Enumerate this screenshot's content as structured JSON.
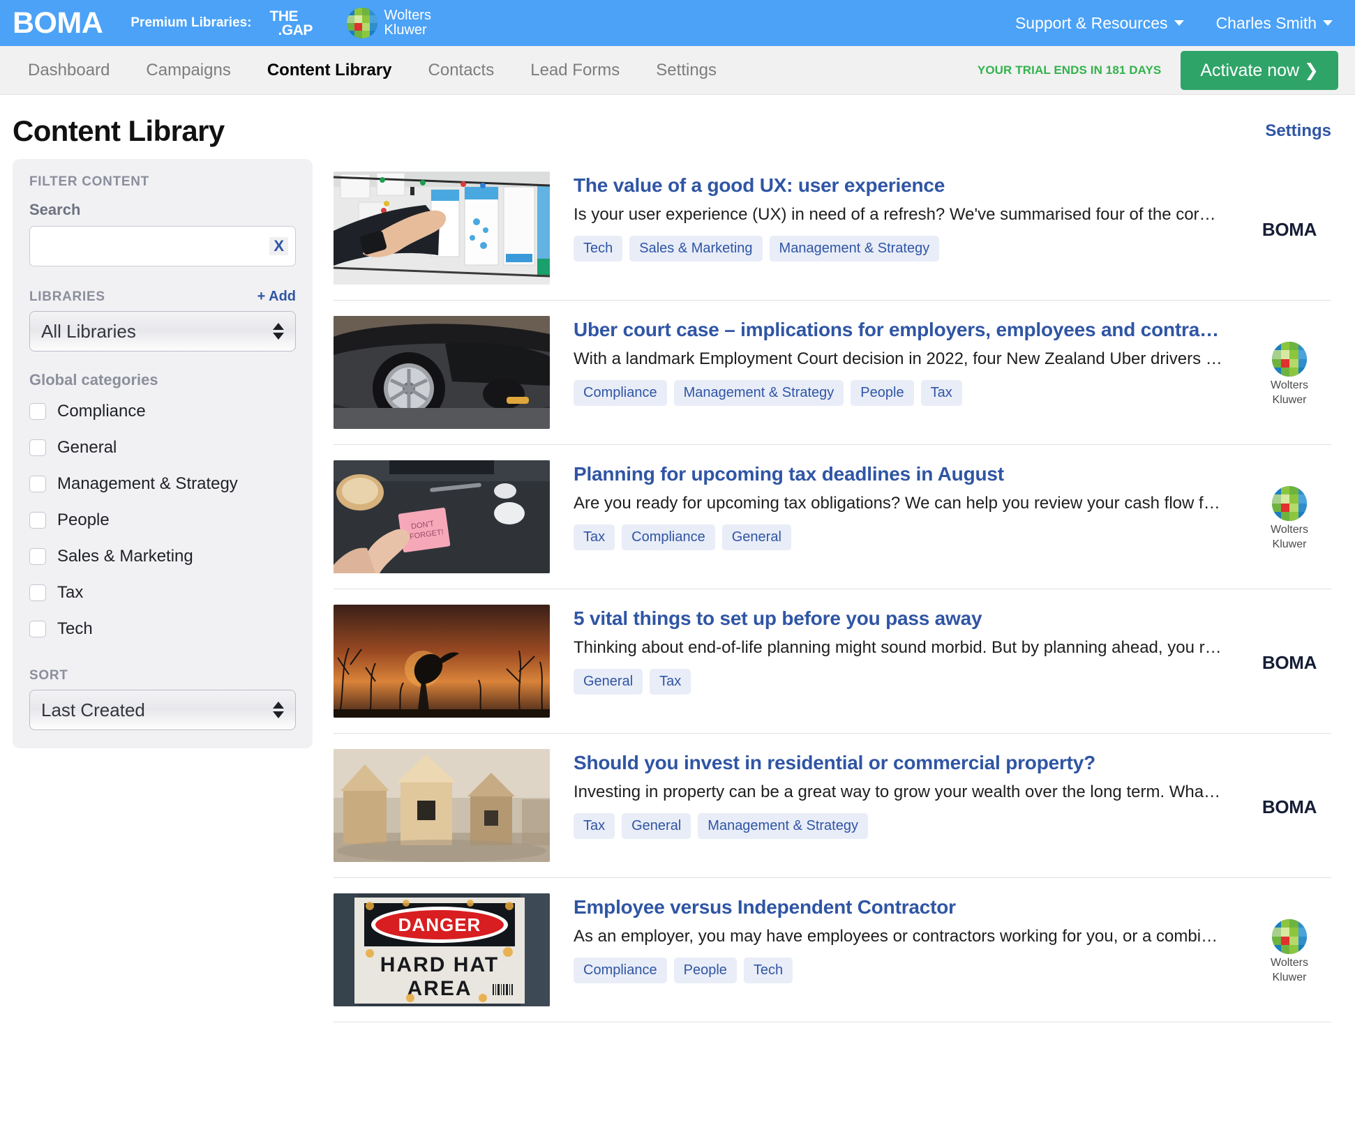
{
  "topbar": {
    "logo": "BOMA",
    "premium_label": "Premium Libraries:",
    "thegap_line1": "THE",
    "thegap_line2": ".GAP",
    "wolters_line1": "Wolters",
    "wolters_line2": "Kluwer",
    "support_menu": "Support & Resources",
    "user_menu": "Charles Smith"
  },
  "nav": {
    "items": [
      {
        "label": "Dashboard",
        "active": false
      },
      {
        "label": "Campaigns",
        "active": false
      },
      {
        "label": "Content Library",
        "active": true
      },
      {
        "label": "Contacts",
        "active": false
      },
      {
        "label": "Lead Forms",
        "active": false
      },
      {
        "label": "Settings",
        "active": false
      }
    ],
    "trial_text": "YOUR TRIAL ENDS IN 181 DAYS",
    "activate_label": "Activate now ❯"
  },
  "page": {
    "title": "Content Library",
    "settings_link": "Settings"
  },
  "sidebar": {
    "filter_title": "FILTER CONTENT",
    "search_label": "Search",
    "search_value": "",
    "search_placeholder": "",
    "search_clear_label": "X",
    "libraries_label": "LIBRARIES",
    "add_label": "+ Add",
    "library_selected": "All Libraries",
    "global_categories_label": "Global categories",
    "categories": [
      {
        "label": "Compliance",
        "checked": false
      },
      {
        "label": "General",
        "checked": false
      },
      {
        "label": "Management & Strategy",
        "checked": false
      },
      {
        "label": "People",
        "checked": false
      },
      {
        "label": "Sales & Marketing",
        "checked": false
      },
      {
        "label": "Tax",
        "checked": false
      },
      {
        "label": "Tech",
        "checked": false
      }
    ],
    "sort_label": "SORT",
    "sort_selected": "Last Created"
  },
  "content_items": [
    {
      "title": "The value of a good UX: user experience",
      "description": "Is your user experience (UX) in need of a refresh? We've summarised four of the core are…",
      "tags": [
        "Tech",
        "Sales & Marketing",
        "Management & Strategy"
      ],
      "brand": "BOMA",
      "thumb": "ux-sticky-notes-wall"
    },
    {
      "title": "Uber court case – implications for employers, employees and contract…",
      "description": "With a landmark Employment Court decision in 2022, four New Zealand Uber drivers wo…",
      "tags": [
        "Compliance",
        "Management & Strategy",
        "People",
        "Tax"
      ],
      "brand": "Wolters Kluwer",
      "thumb": "car-wheel"
    },
    {
      "title": "Planning for upcoming tax deadlines in August",
      "description": "Are you ready for upcoming tax obligations? We can help you review your cash flow fore…",
      "tags": [
        "Tax",
        "Compliance",
        "General"
      ],
      "brand": "Wolters Kluwer",
      "thumb": "desk-sticky-note"
    },
    {
      "title": "5 vital things to set up before you pass away",
      "description": "Thinking about end-of-life planning might sound morbid. But by planning ahead, you rem…",
      "tags": [
        "General",
        "Tax"
      ],
      "brand": "BOMA",
      "thumb": "sunset-bird"
    },
    {
      "title": "Should you invest in residential or commercial property?",
      "description": "Investing in property can be a great way to grow your wealth over the long term. What ar…",
      "tags": [
        "Tax",
        "General",
        "Management & Strategy"
      ],
      "brand": "BOMA",
      "thumb": "wooden-houses"
    },
    {
      "title": "Employee versus Independent Contractor",
      "description": "As an employer, you may have employees or contractors working for you, or a combinati…",
      "tags": [
        "Compliance",
        "People",
        "Tech"
      ],
      "brand": "Wolters Kluwer",
      "thumb": "danger-hard-hat-area-sign"
    }
  ],
  "colors": {
    "header_blue": "#4ba2f7",
    "link_blue": "#2f55a4",
    "trial_green": "#33b24c",
    "activate_green": "#2fa468",
    "tag_bg": "#e9edf8",
    "sidebar_bg": "#f1f1f3"
  }
}
